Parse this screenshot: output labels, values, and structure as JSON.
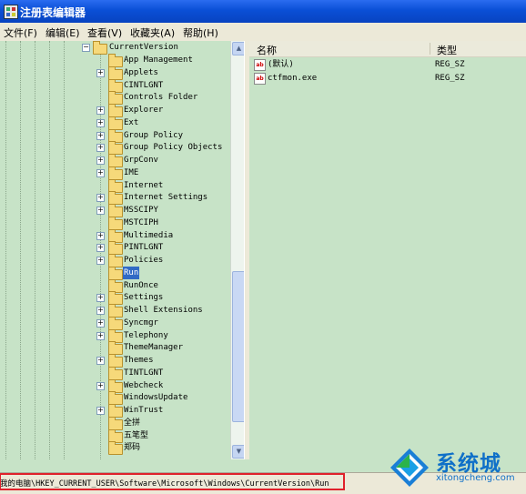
{
  "window": {
    "title": "注册表编辑器"
  },
  "menu": [
    "文件(F)",
    "编辑(E)",
    "查看(V)",
    "收藏夹(A)",
    "帮助(H)"
  ],
  "tree": {
    "parent": "CurrentVersion",
    "items": [
      {
        "label": "App Management",
        "expandable": false
      },
      {
        "label": "Applets",
        "expandable": true
      },
      {
        "label": "CINTLGNT",
        "expandable": false
      },
      {
        "label": "Controls Folder",
        "expandable": false
      },
      {
        "label": "Explorer",
        "expandable": true
      },
      {
        "label": "Ext",
        "expandable": true
      },
      {
        "label": "Group Policy",
        "expandable": true
      },
      {
        "label": "Group Policy Objects",
        "expandable": true
      },
      {
        "label": "GrpConv",
        "expandable": true
      },
      {
        "label": "IME",
        "expandable": true
      },
      {
        "label": "Internet",
        "expandable": false
      },
      {
        "label": "Internet Settings",
        "expandable": true
      },
      {
        "label": "MSSCIPY",
        "expandable": true
      },
      {
        "label": "MSTCIPH",
        "expandable": false
      },
      {
        "label": "Multimedia",
        "expandable": true
      },
      {
        "label": "PINTLGNT",
        "expandable": true
      },
      {
        "label": "Policies",
        "expandable": true
      },
      {
        "label": "Run",
        "expandable": false,
        "selected": true
      },
      {
        "label": "RunOnce",
        "expandable": false
      },
      {
        "label": "Settings",
        "expandable": true
      },
      {
        "label": "Shell Extensions",
        "expandable": true
      },
      {
        "label": "Syncmgr",
        "expandable": true
      },
      {
        "label": "Telephony",
        "expandable": true
      },
      {
        "label": "ThemeManager",
        "expandable": false
      },
      {
        "label": "Themes",
        "expandable": true
      },
      {
        "label": "TINTLGNT",
        "expandable": false
      },
      {
        "label": "Webcheck",
        "expandable": true
      },
      {
        "label": "WindowsUpdate",
        "expandable": false
      },
      {
        "label": "WinTrust",
        "expandable": true
      },
      {
        "label": "全拼",
        "expandable": false
      },
      {
        "label": "五笔型",
        "expandable": false
      },
      {
        "label": "郑码",
        "expandable": false
      }
    ]
  },
  "list": {
    "columns": {
      "name": "名称",
      "type": "类型"
    },
    "rows": [
      {
        "name": "(默认)",
        "type": "REG_SZ"
      },
      {
        "name": "ctfmon.exe",
        "type": "REG_SZ"
      }
    ]
  },
  "statusbar": {
    "path": "我的电脑\\HKEY_CURRENT_USER\\Software\\Microsoft\\Windows\\CurrentVersion\\Run"
  },
  "watermark": {
    "title": "系统城",
    "url": "xitongcheng.com"
  },
  "colors": {
    "selection": "#316ac5",
    "background": "#c7e3c7",
    "highlight_box": "#e0212b",
    "titlebar": "#0a4fd6"
  }
}
